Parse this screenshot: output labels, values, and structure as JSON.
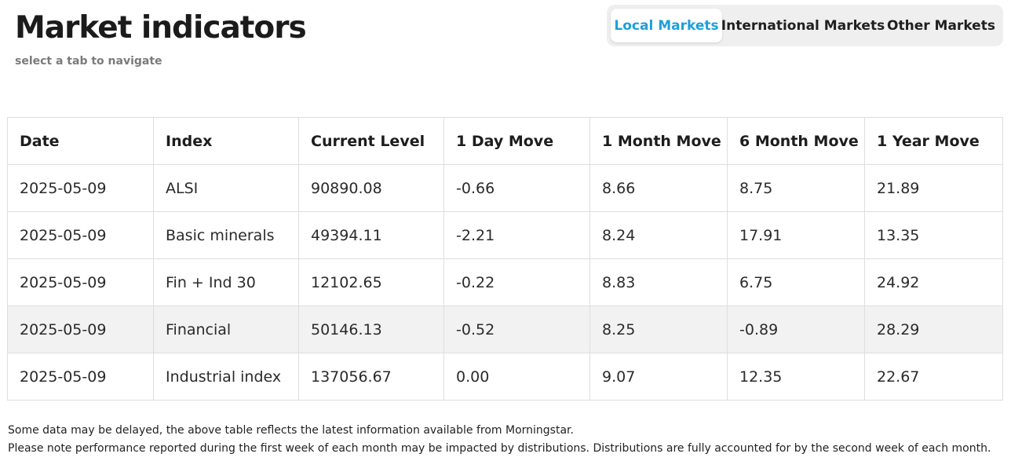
{
  "header": {
    "title": "Market indicators",
    "subtitle": "select a tab to navigate"
  },
  "tabs": [
    {
      "label": "Local Markets",
      "active": true
    },
    {
      "label": "International Markets",
      "active": false
    },
    {
      "label": "Other Markets",
      "active": false
    }
  ],
  "table": {
    "columns": [
      "Date",
      "Index",
      "Current Level",
      "1 Day Move",
      "1 Month Move",
      "6 Month Move",
      "1 Year Move"
    ],
    "rows": [
      [
        "2025-05-09",
        "ALSI",
        "90890.08",
        "-0.66",
        "8.66",
        "8.75",
        "21.89"
      ],
      [
        "2025-05-09",
        "Basic minerals",
        "49394.11",
        "-2.21",
        "8.24",
        "17.91",
        "13.35"
      ],
      [
        "2025-05-09",
        "Fin + Ind 30",
        "12102.65",
        "-0.22",
        "8.83",
        "6.75",
        "24.92"
      ],
      [
        "2025-05-09",
        "Financial",
        "50146.13",
        "-0.52",
        "8.25",
        "-0.89",
        "28.29"
      ],
      [
        "2025-05-09",
        "Industrial index",
        "137056.67",
        "0.00",
        "9.07",
        "12.35",
        "22.67"
      ]
    ]
  },
  "footer": {
    "line1": "Some data may be delayed, the above table reflects the latest information available from Morningstar.",
    "line2": "Please note performance reported during the first week of each month may be impacted by distributions. Distributions are fully accounted for by the second week of each month."
  },
  "colors": {
    "accent": "#1ea0d8",
    "tab_bar_bg": "#efefef",
    "row_highlight": "#f2f2f2",
    "border": "#dedede"
  }
}
